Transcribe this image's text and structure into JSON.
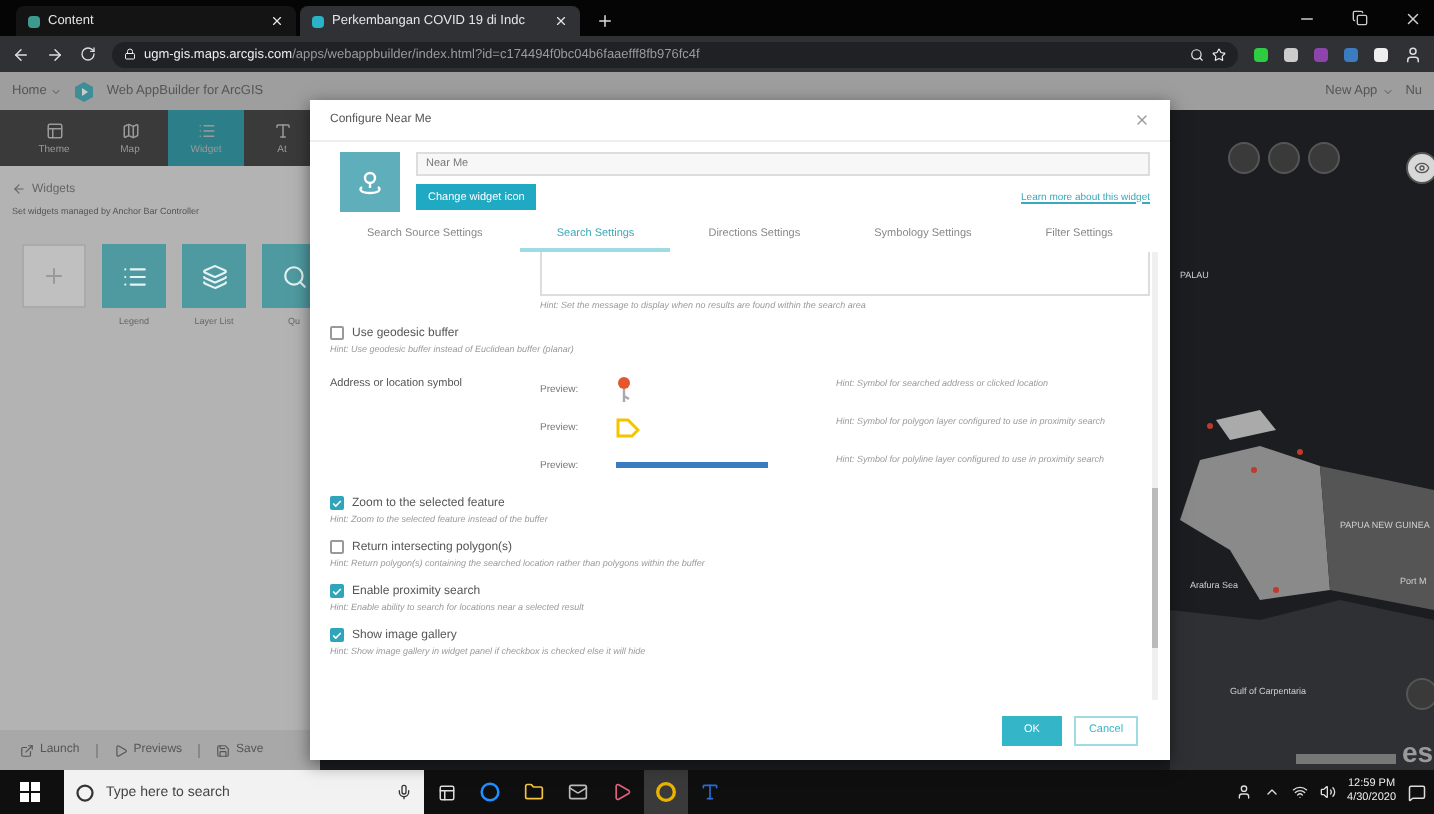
{
  "browser": {
    "tabs": [
      {
        "title": "Content",
        "selected": false
      },
      {
        "title": "Perkembangan COVID 19 di Indc",
        "selected": true
      }
    ],
    "url_host": "ugm-gis.maps.arcgis.com",
    "url_path": "/apps/webappbuilder/index.html?id=c174494f0bc04b6faaefff8fb976fc4f"
  },
  "app_header": {
    "home": "Home",
    "title": "Web AppBuilder for ArcGIS",
    "new_app": "New App",
    "user": "Nu"
  },
  "side_panel": {
    "tabs": [
      {
        "label": "Theme",
        "kind": "theme",
        "selected": false
      },
      {
        "label": "Map",
        "kind": "map",
        "selected": false
      },
      {
        "label": "Widget",
        "kind": "widget",
        "selected": true
      },
      {
        "label": "At",
        "kind": "attribute",
        "selected": false
      }
    ],
    "heading": "Widgets",
    "subtitle": "Set widgets managed by Anchor Bar Controller",
    "widgets": [
      {
        "kind": "add"
      },
      {
        "kind": "legend",
        "label": "Legend"
      },
      {
        "kind": "layers",
        "label": "Layer List"
      },
      {
        "kind": "query",
        "label": "Qu"
      }
    ],
    "footer": [
      {
        "kind": "launch",
        "label": "Launch"
      },
      {
        "kind": "preview",
        "label": "Previews"
      },
      {
        "kind": "save",
        "label": "Save"
      }
    ]
  },
  "map": {
    "labels": [
      "PALAU",
      "PAPUA NEW GUINEA",
      "Arafura Sea",
      "Gulf of Carpentaria",
      "Port M"
    ],
    "logo_text": "es"
  },
  "dialog": {
    "title": "Configure Near Me",
    "name_value": "Near Me",
    "change_icon": "Change widget icon",
    "learn_more": "Learn more about this widget",
    "tabs": [
      {
        "label": "Search Source Settings",
        "selected": false
      },
      {
        "label": "Search Settings",
        "selected": true
      },
      {
        "label": "Directions Settings",
        "selected": false
      },
      {
        "label": "Symbology Settings",
        "selected": false
      },
      {
        "label": "Filter Settings",
        "selected": false
      }
    ],
    "message_hint": "Hint: Set the message to display when no results are found within the search area",
    "geodesic": {
      "label": "Use geodesic buffer",
      "hint": "Hint: Use geodesic buffer instead of Euclidean buffer (planar)",
      "checked": false
    },
    "symbols": {
      "label": "Address or location symbol",
      "previews": [
        {
          "kind": "pin",
          "label": "Preview:",
          "hint": "Hint: Symbol for searched address or clicked location"
        },
        {
          "kind": "polygon",
          "label": "Preview:",
          "hint": "Hint: Symbol for polygon layer configured to use in proximity search"
        },
        {
          "kind": "line",
          "label": "Preview:",
          "hint": "Hint: Symbol for polyline layer configured to use in proximity search"
        }
      ]
    },
    "options": [
      {
        "label": "Zoom to the selected feature",
        "hint": "Hint: Zoom to the selected feature instead of the buffer",
        "checked": true
      },
      {
        "label": "Return intersecting polygon(s)",
        "hint": "Hint: Return polygon(s) containing the searched location rather than polygons within the buffer",
        "checked": false
      },
      {
        "label": "Enable proximity search",
        "hint": "Hint: Enable ability to search for locations near a selected result",
        "checked": true
      },
      {
        "label": "Show image gallery",
        "hint": "Hint: Show image gallery in widget panel if checkbox is checked else it will hide",
        "checked": true
      }
    ],
    "buttons": {
      "ok": "OK",
      "cancel": "Cancel"
    }
  },
  "taskbar": {
    "search_placeholder": "Type here to search",
    "time": "12:59 PM",
    "date": "4/30/2020"
  }
}
